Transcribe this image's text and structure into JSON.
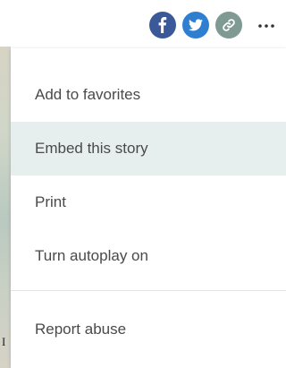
{
  "share": {
    "facebook_icon": "facebook-icon",
    "facebook_color": "#3b5998",
    "twitter_icon": "twitter-icon",
    "twitter_color": "#2f7fd1",
    "link_icon": "link-icon",
    "link_color": "#7f9a92"
  },
  "more_icon": "more-icon",
  "menu": {
    "items": [
      {
        "label": "Add to favorites"
      },
      {
        "label": "Embed this story",
        "highlighted": true
      },
      {
        "label": "Print"
      },
      {
        "label": "Turn autoplay on"
      },
      {
        "label": "Report abuse"
      }
    ],
    "highlight_color": "#e6efee"
  }
}
